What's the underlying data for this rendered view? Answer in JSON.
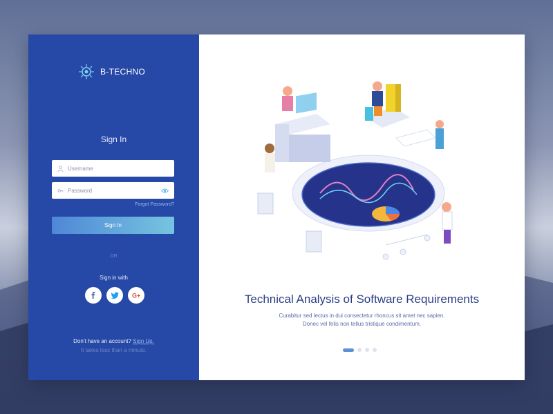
{
  "brand": {
    "name": "B-TECHNO",
    "logo_icon": "chip-icon"
  },
  "signin": {
    "title": "Sign In",
    "username_placeholder": "Username",
    "password_placeholder": "Password",
    "username_icon": "user-icon",
    "password_icon": "key-icon",
    "show_password_icon": "eye-icon",
    "forgot_label": "Forgot Password?",
    "button_label": "Sign In",
    "or_label": "OR",
    "signin_with_label": "Sign in with",
    "socials": [
      {
        "name": "facebook",
        "glyph": "f",
        "color": "#3b5998"
      },
      {
        "name": "twitter",
        "glyph": "t",
        "color": "#1da1f2"
      },
      {
        "name": "google",
        "glyph": "G+",
        "color": "#dd4b39"
      }
    ],
    "footer_text": "Don't have an account?",
    "signup_label": "Sign Up.",
    "footer_note": "It takes less than a minute."
  },
  "hero": {
    "headline": "Technical Analysis of Software Requirements",
    "subline_1": "Curabitur sed lectus in dui consectetur rhoncus sit amet nec sapien.",
    "subline_2": "Donec vel felis non tellus tristique condimentum.",
    "slides": 4,
    "active_slide": 0
  },
  "colors": {
    "panel": "#2648a6",
    "accent": "#5b8fd6",
    "headline": "#2b3f85"
  }
}
